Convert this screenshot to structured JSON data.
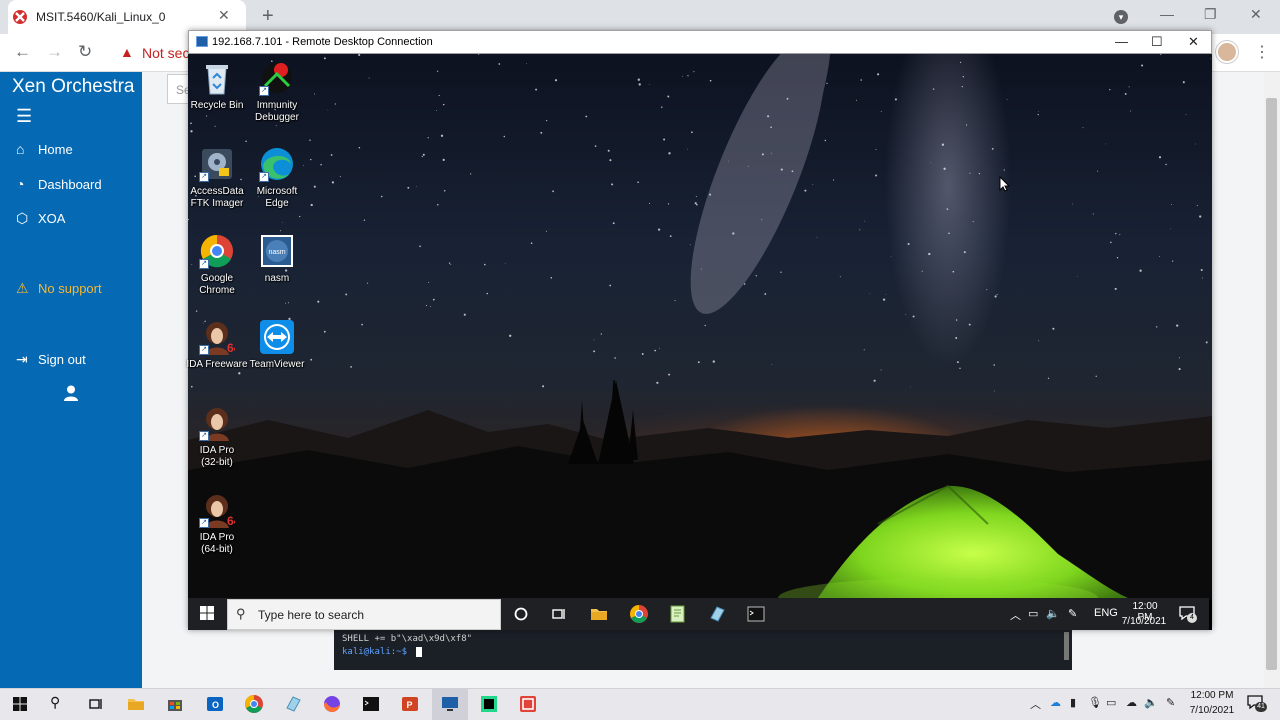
{
  "browser": {
    "tab_title": "MSIT.5460/Kali_Linux_0",
    "tab_close": "✕",
    "new_tab": "+",
    "address_warning": "Not sec",
    "window_controls": [
      "—",
      "❐",
      "✕"
    ]
  },
  "xen_orchestra": {
    "title": "Xen Orchestra",
    "search_placeholder": "Se",
    "menu": [
      {
        "label": "Home",
        "icon": "home-icon"
      },
      {
        "label": "Dashboard",
        "icon": "dashboard-icon"
      },
      {
        "label": "XOA",
        "icon": "cube-icon"
      },
      {
        "label": "No support",
        "icon": "warning-icon"
      },
      {
        "label": "Sign out",
        "icon": "sign-out-icon"
      }
    ]
  },
  "terminal": {
    "line1": "SHELL += b\"\\xad\\x9d\\xf8\"",
    "prompt": "kali@kali:~$"
  },
  "rdp": {
    "title": "192.168.7.101 - Remote Desktop Connection",
    "controls": [
      "—",
      "☐",
      "✕"
    ],
    "desktop_icons": [
      {
        "label1": "Recycle Bin",
        "label2": ""
      },
      {
        "label1": "Immunity",
        "label2": "Debugger"
      },
      {
        "label1": "AccessData",
        "label2": "FTK Imager"
      },
      {
        "label1": "Microsoft",
        "label2": "Edge"
      },
      {
        "label1": "Google",
        "label2": "Chrome"
      },
      {
        "label1": "nasm",
        "label2": ""
      },
      {
        "label1": "IDA Freeware",
        "label2": ""
      },
      {
        "label1": "TeamViewer",
        "label2": ""
      },
      {
        "label1": "IDA Pro",
        "label2": "(32-bit)"
      },
      {
        "label1": "IDA Pro",
        "label2": "(64-bit)"
      }
    ],
    "taskbar": {
      "search_text": "Type here to search",
      "lang": "ENG",
      "time": "12:00 PM",
      "date": "7/10/2021",
      "notification_count": "4"
    }
  },
  "host_taskbar": {
    "time": "12:00 PM",
    "date": "7/10/2021",
    "notification_count": "41"
  },
  "colors": {
    "xo_blue": "#0569b4",
    "warning_orange": "#f7b733",
    "tent_green": "#7fd61e"
  }
}
